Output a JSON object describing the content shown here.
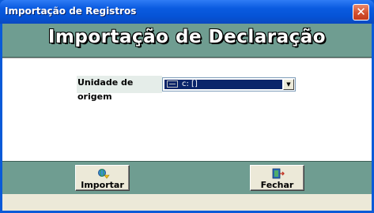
{
  "window": {
    "title": "Importação de Registros",
    "close_glyph": "✕"
  },
  "header": {
    "title": "Importação de Declaração"
  },
  "form": {
    "origin_label": "Unidade de origem",
    "origin_value": "c: []",
    "origin_icon": "drive-icon",
    "dropdown_glyph": "▼"
  },
  "footer": {
    "import_label": "Importar",
    "import_icon": "import-icon",
    "close_label": "Fechar",
    "close_icon": "exit-door-icon"
  },
  "colors": {
    "title_bar": "#0553d6",
    "band": "#6f9d91",
    "selection": "#0a246a"
  }
}
